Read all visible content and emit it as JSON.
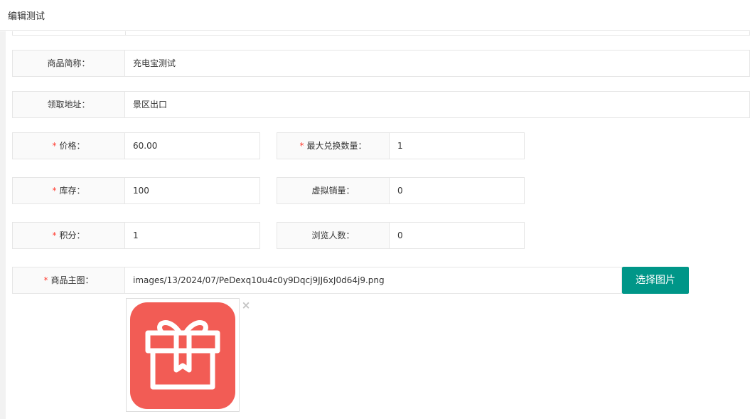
{
  "header": {
    "title": "编辑测试"
  },
  "fields": {
    "name": {
      "label": "商品简称：",
      "value": "充电宝测试"
    },
    "address": {
      "label": "领取地址：",
      "value": "景区出口"
    },
    "price": {
      "required": "*",
      "label": "价格：",
      "value": "60.00"
    },
    "max_redeem": {
      "required": "*",
      "label": "最大兑换数量：",
      "value": "1"
    },
    "stock": {
      "required": "*",
      "label": "库存：",
      "value": "100"
    },
    "virtual_sales": {
      "label": "虚拟销量：",
      "value": "0"
    },
    "points": {
      "required": "*",
      "label": "积分：",
      "value": "1"
    },
    "views": {
      "label": "浏览人数：",
      "value": "0"
    },
    "main_image": {
      "required": "*",
      "label": "商品主图：",
      "value": "images/13/2024/07/PeDexq10u4c0y9Dqcj9JJ6xJ0d64j9.png"
    }
  },
  "buttons": {
    "select_image": "选择图片",
    "remove_image": "×"
  },
  "image_preview": {
    "icon": "gift-icon",
    "bg_color": "#f25c55"
  },
  "colors": {
    "accent": "#009688",
    "required": "#ff3b2f"
  }
}
